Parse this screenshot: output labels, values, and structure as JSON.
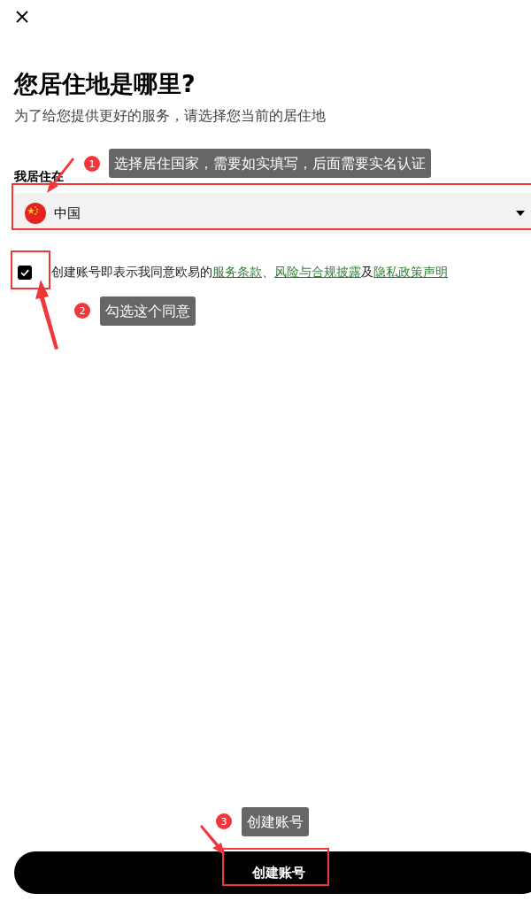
{
  "title": "您居住地是哪里?",
  "subtitle": "为了给您提供更好的服务，请选择您当前的居住地",
  "residence": {
    "label": "我居住在",
    "value": "中国"
  },
  "agreement": {
    "checked": true,
    "segments": [
      {
        "kind": "text",
        "text": "创建账号即表示我同意欧易的"
      },
      {
        "kind": "link",
        "text": "服务条款"
      },
      {
        "kind": "text",
        "text": "、"
      },
      {
        "kind": "link",
        "text": "风险与合规披露"
      },
      {
        "kind": "text",
        "text": "及"
      },
      {
        "kind": "link",
        "text": "隐私政策声明"
      }
    ]
  },
  "submit_button": "创建账号",
  "annotations": [
    {
      "number": "1",
      "text": "选择居住国家，需要如实填写，后面需要实名认证"
    },
    {
      "number": "2",
      "text": "勾选这个同意"
    },
    {
      "number": "3",
      "text": "创建账号"
    }
  ]
}
